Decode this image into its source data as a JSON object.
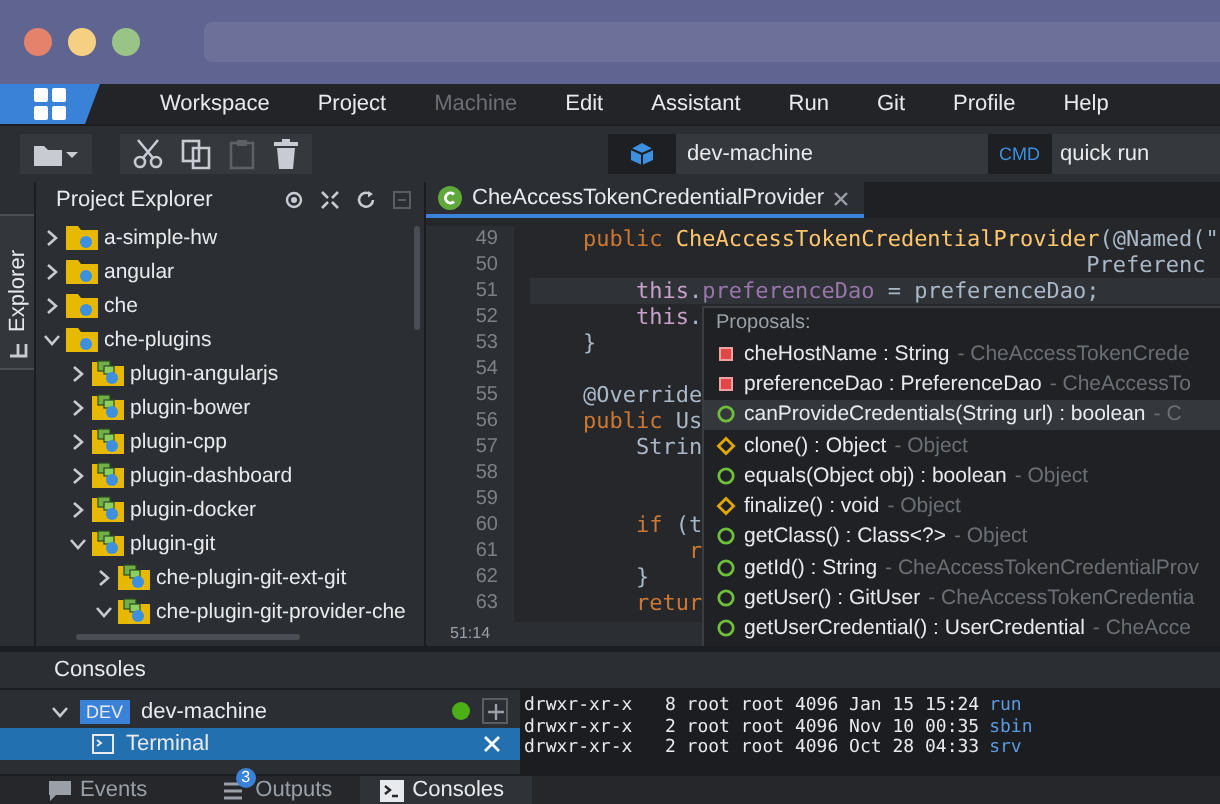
{
  "menu_bar": {
    "items": [
      {
        "label": "Workspace",
        "disabled": false
      },
      {
        "label": "Project",
        "disabled": false
      },
      {
        "label": "Machine",
        "disabled": true
      },
      {
        "label": "Edit",
        "disabled": false
      },
      {
        "label": "Assistant",
        "disabled": false
      },
      {
        "label": "Run",
        "disabled": false
      },
      {
        "label": "Git",
        "disabled": false
      },
      {
        "label": "Profile",
        "disabled": false
      },
      {
        "label": "Help",
        "disabled": false
      }
    ]
  },
  "toolbar": {
    "buttons": [
      {
        "kind": "new-folder",
        "disabled": false
      },
      {
        "kind": "cut",
        "disabled": false
      },
      {
        "kind": "copy",
        "disabled": false
      },
      {
        "kind": "paste",
        "disabled": true
      },
      {
        "kind": "delete",
        "disabled": false
      }
    ],
    "machine": "dev-machine",
    "command_badge": "CMD",
    "command": "quick run"
  },
  "side_tabs": [
    {
      "label": "Explorer",
      "selected": true
    }
  ],
  "project_explorer": {
    "title": "Project Explorer",
    "tree": [
      {
        "label": "a-simple-hw",
        "kind": "folder",
        "expanded": false
      },
      {
        "label": "angular",
        "kind": "folder",
        "expanded": false
      },
      {
        "label": "che",
        "kind": "folder",
        "expanded": false
      },
      {
        "label": "che-plugins",
        "kind": "folder",
        "expanded": true,
        "children": [
          {
            "label": "plugin-angularjs",
            "kind": "module",
            "expanded": false
          },
          {
            "label": "plugin-bower",
            "kind": "module",
            "expanded": false
          },
          {
            "label": "plugin-cpp",
            "kind": "module",
            "expanded": false
          },
          {
            "label": "plugin-dashboard",
            "kind": "module",
            "expanded": false
          },
          {
            "label": "plugin-docker",
            "kind": "module",
            "expanded": false
          },
          {
            "label": "plugin-git",
            "kind": "module",
            "expanded": true,
            "children": [
              {
                "label": "che-plugin-git-ext-git",
                "kind": "module",
                "expanded": false
              },
              {
                "label": "che-plugin-git-provider-che",
                "kind": "module",
                "expanded": true
              }
            ]
          }
        ]
      }
    ]
  },
  "editor": {
    "tabs": [
      {
        "label": "CheAccessTokenCredentialProvider",
        "selected": true
      }
    ],
    "lines": [
      {
        "number": "49",
        "current": false,
        "tokens": [
          {
            "kind": "keyword",
            "text": "    public"
          },
          {
            "kind": "method",
            "text": " CheAccessTokenCredentialProvider"
          },
          {
            "kind": "plain",
            "text": "(@Named(\""
          }
        ]
      },
      {
        "number": "50",
        "current": false,
        "tokens": [
          {
            "kind": "plain",
            "text": "                                          Preferenc"
          }
        ]
      },
      {
        "number": "51",
        "current": true,
        "tokens": [
          {
            "kind": "this",
            "text": "        this"
          },
          {
            "kind": "plain",
            "text": "."
          },
          {
            "kind": "field",
            "text": "preferenceDao"
          },
          {
            "kind": "plain",
            "text": " = preferenceDao;"
          }
        ]
      },
      {
        "number": "52",
        "current": false,
        "tokens": [
          {
            "kind": "this",
            "text": "        this"
          },
          {
            "kind": "plain",
            "text": "."
          }
        ]
      },
      {
        "number": "53",
        "current": false,
        "tokens": [
          {
            "kind": "plain",
            "text": "    }"
          }
        ]
      },
      {
        "number": "54",
        "current": false
      },
      {
        "number": "55",
        "current": false,
        "tokens": [
          {
            "kind": "annotation",
            "text": "    @Override"
          }
        ]
      },
      {
        "number": "56",
        "current": false,
        "tokens": [
          {
            "kind": "keyword",
            "text": "    public"
          },
          {
            "kind": "plain",
            "text": " Us"
          }
        ]
      },
      {
        "number": "57",
        "current": false,
        "tokens": [
          {
            "kind": "plain",
            "text": "        Strin"
          }
        ]
      },
      {
        "number": "58",
        "current": false
      },
      {
        "number": "59",
        "current": false
      },
      {
        "number": "60",
        "current": false,
        "tokens": [
          {
            "kind": "keyword",
            "text": "        if"
          },
          {
            "kind": "plain",
            "text": " (t"
          }
        ]
      },
      {
        "number": "61",
        "current": false,
        "tokens": [
          {
            "kind": "keyword",
            "text": "            r"
          }
        ]
      },
      {
        "number": "62",
        "current": false,
        "tokens": [
          {
            "kind": "plain",
            "text": "        }"
          }
        ]
      },
      {
        "number": "63",
        "current": false,
        "tokens": [
          {
            "kind": "keyword",
            "text": "        retur"
          }
        ]
      }
    ],
    "cursor": "51:14",
    "proposals": {
      "title": "Proposals:",
      "items": [
        {
          "kind": "field",
          "label": "cheHostName : String",
          "detail": "- CheAccessTokenCrede",
          "selected": false
        },
        {
          "kind": "field",
          "label": "preferenceDao : PreferenceDao",
          "detail": "- CheAccessTo",
          "selected": false
        },
        {
          "kind": "method",
          "label": "canProvideCredentials(String url) : boolean",
          "detail": "- C",
          "selected": true
        },
        {
          "kind": "protected",
          "label": "clone() : Object",
          "detail": "- Object",
          "selected": false
        },
        {
          "kind": "method",
          "label": "equals(Object obj) : boolean",
          "detail": "- Object",
          "selected": false
        },
        {
          "kind": "protected",
          "label": "finalize() : void",
          "detail": "- Object",
          "selected": false
        },
        {
          "kind": "method",
          "label": "getClass() : Class<?>",
          "detail": "- Object",
          "selected": false
        },
        {
          "kind": "method",
          "label": "getId() : String",
          "detail": "- CheAccessTokenCredentialProv",
          "selected": false
        },
        {
          "kind": "method",
          "label": "getUser() : GitUser",
          "detail": "- CheAccessTokenCredentia",
          "selected": false
        },
        {
          "kind": "method",
          "label": "getUserCredential() : UserCredential",
          "detail": "- CheAcce",
          "selected": false
        }
      ]
    }
  },
  "consoles": {
    "title": "Consoles",
    "machines": [
      {
        "badge": "DEV",
        "name": "dev-machine",
        "expanded": true,
        "running": true,
        "children": [
          {
            "label": "Terminal",
            "selected": true
          }
        ]
      }
    ],
    "output": [
      {
        "text": "drwxr-xr-x   8 root root 4096 Jan 15 15:24",
        "name": "run"
      },
      {
        "text": "drwxr-xr-x   2 root root 4096 Nov 10 00:35",
        "name": "sbin"
      },
      {
        "text": "drwxr-xr-x   2 root root 4096 Oct 28 04:33",
        "name": "srv"
      }
    ]
  },
  "bottom_tabs": [
    {
      "kind": "events",
      "label": "Events",
      "selected": false
    },
    {
      "kind": "outputs",
      "label": "Outputs",
      "badge": "3",
      "selected": false
    },
    {
      "kind": "consoles",
      "label": "Consoles",
      "selected": true
    }
  ]
}
